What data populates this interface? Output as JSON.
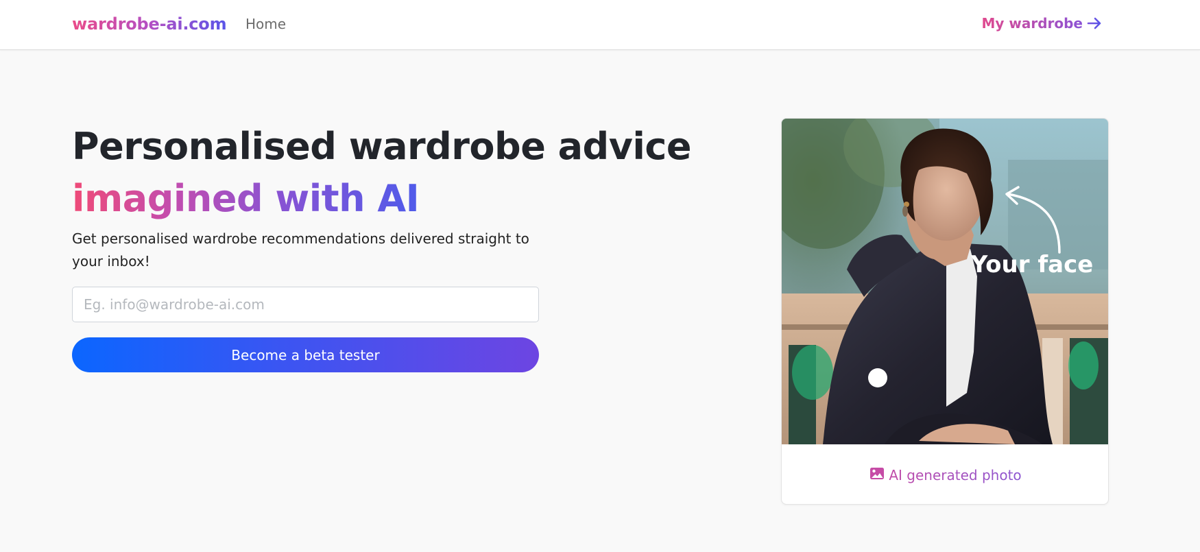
{
  "nav": {
    "brand": "wardrobe-ai.com",
    "home": "Home",
    "my_wardrobe": "My wardrobe",
    "my_wardrobe_icon": "arrow-right-icon"
  },
  "hero": {
    "title": "Personalised wardrobe advice",
    "subtitle": "imagined with AI",
    "description": "Get personalised wardrobe recommendations delivered straight to your inbox!",
    "email_placeholder": "Eg. info@wardrobe-ai.com",
    "email_value": "",
    "cta": "Become a beta tester"
  },
  "card": {
    "photo_overlay": "Your face",
    "caption": "AI generated photo",
    "caption_icon": "image-icon"
  },
  "colors": {
    "brand_pink": "#ea4c89",
    "brand_purple": "#8b52d6",
    "brand_blue": "#5a55e8",
    "cta_start": "#0b66ff",
    "cta_end": "#6d45e2",
    "page_background": "#f9f9f9"
  }
}
